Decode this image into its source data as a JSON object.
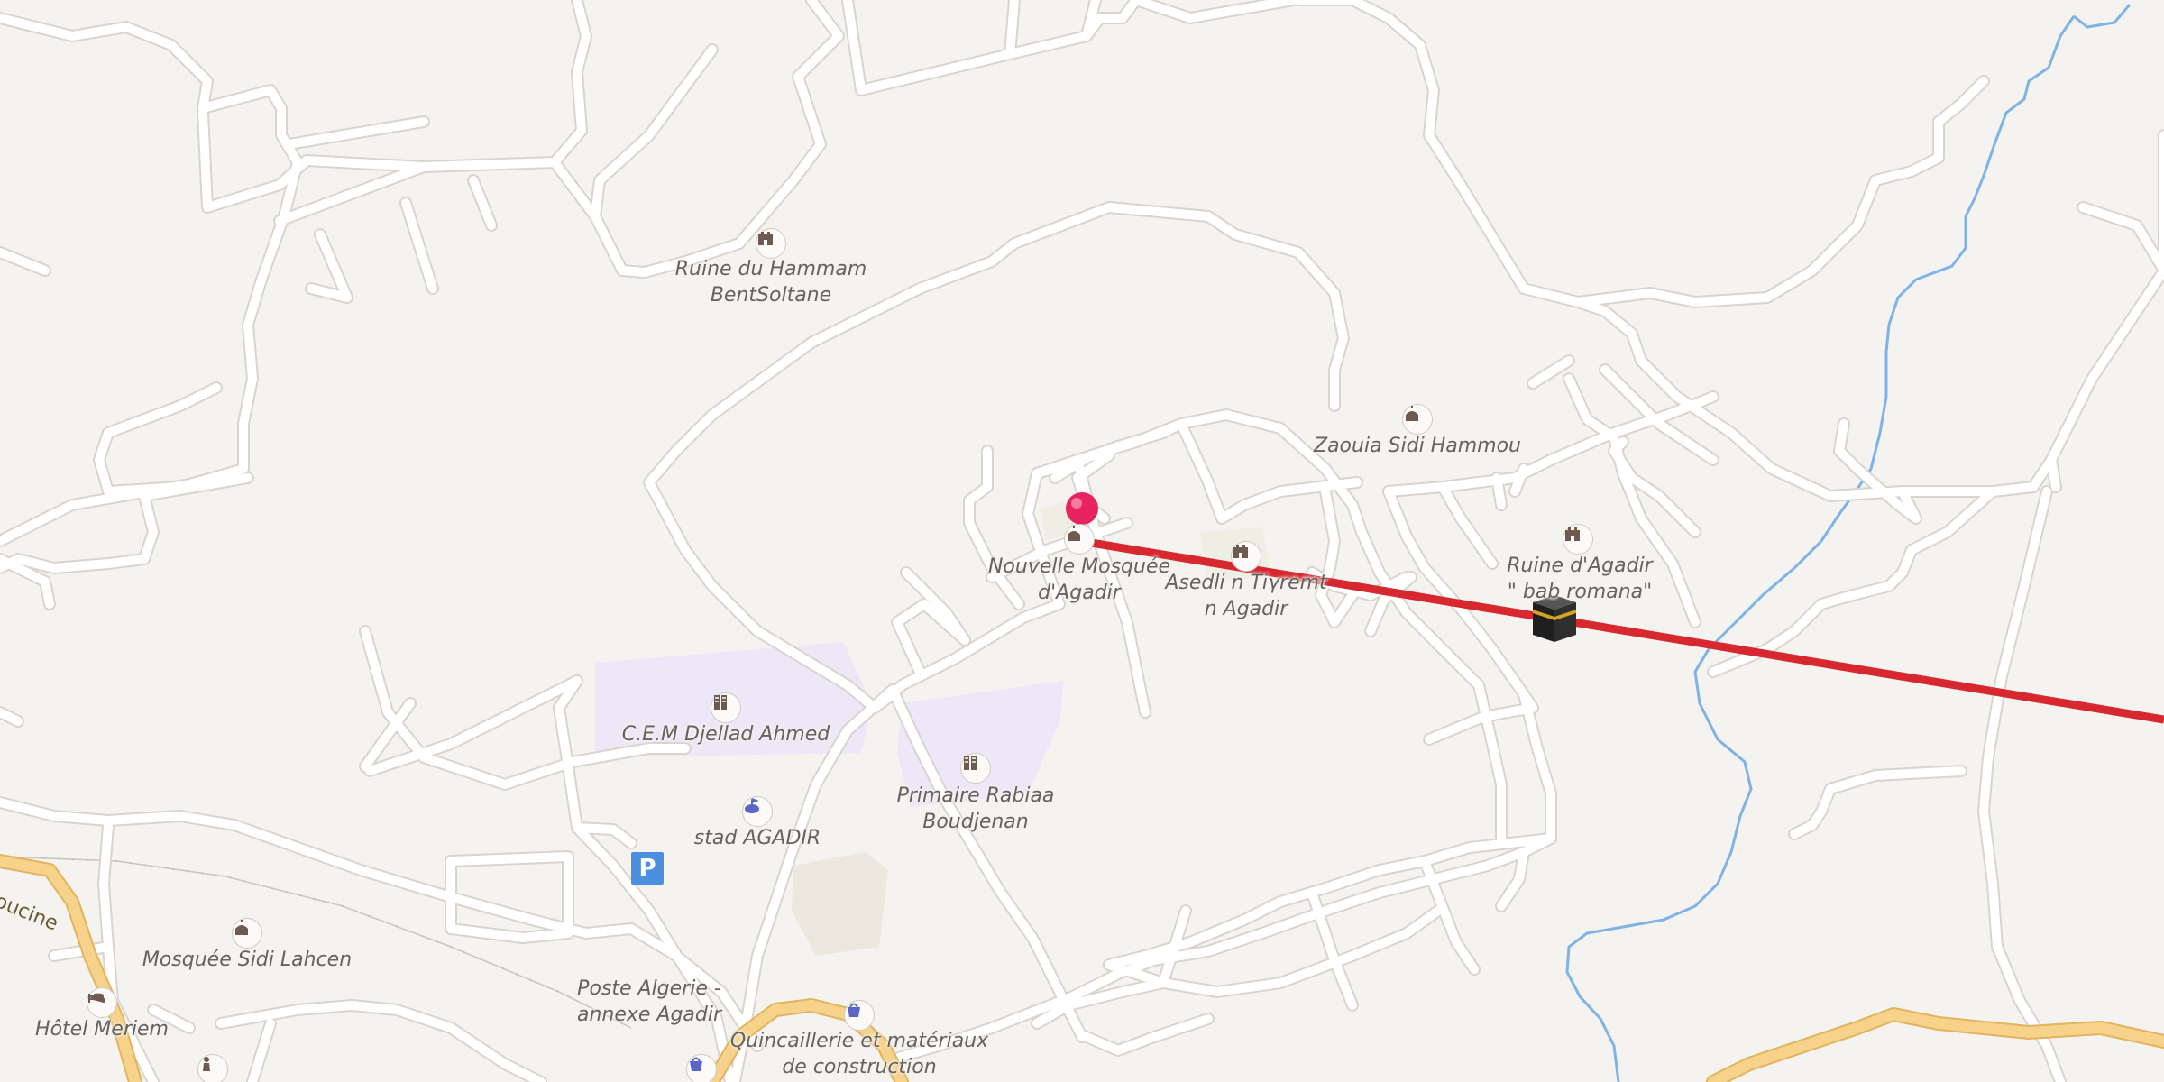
{
  "map": {
    "colors": {
      "background": "#f5f3f0",
      "road": "#ffffff",
      "road_casing": "#d9d4cd",
      "main_road": "#f6d28a",
      "main_road_casing": "#e1b45f",
      "school_area": "#ece8f7",
      "river": "#7fb2e6",
      "route_line": "#d8282f",
      "marker": "#e8245f",
      "poi_icon": "#6e5a4e"
    },
    "places": [
      {
        "id": "ruine-hammam",
        "icon": "ruin-icon",
        "line1": "Ruine du Hammam",
        "line2": "BentSoltane"
      },
      {
        "id": "zaouia",
        "icon": "mosque-icon",
        "line1": "Zaouia Sidi Hammou",
        "line2": ""
      },
      {
        "id": "nouvelle-mosquee",
        "icon": "mosque-icon",
        "line1": "Nouvelle Mosquée",
        "line2": "d'Agadir"
      },
      {
        "id": "asedli",
        "icon": "ruin-icon",
        "line1": "Asedli n Tiγremt",
        "line2": "n Agadir"
      },
      {
        "id": "ruine-agadir",
        "icon": "ruin-icon",
        "line1": "Ruine d'Agadir",
        "line2": "\" bab romana\""
      },
      {
        "id": "cem",
        "icon": "school-icon",
        "line1": "C.E.M Djellad Ahmed",
        "line2": ""
      },
      {
        "id": "primaire",
        "icon": "school-icon",
        "line1": "Primaire Rabiaa",
        "line2": "Boudjenan"
      },
      {
        "id": "stad",
        "icon": "stadium-icon",
        "line1": "stad AGADIR",
        "line2": ""
      },
      {
        "id": "mosquee-sidi-lahcen",
        "icon": "mosque-icon",
        "line1": "Mosquée Sidi Lahcen",
        "line2": ""
      },
      {
        "id": "hotel",
        "icon": "hotel-icon",
        "line1": "Hôtel Meriem",
        "line2": ""
      },
      {
        "id": "poste",
        "icon": "post-icon",
        "line1": "Poste Algerie -",
        "line2": "annexe Agadir"
      },
      {
        "id": "quincaillerie",
        "icon": "shop-icon",
        "line1": "Quincaillerie et matériaux",
        "line2": "de construction"
      }
    ],
    "road_label": "oucine",
    "parking_label": "P",
    "qibla_icon": "kaaba-icon",
    "marker_icon": "location-pin-icon"
  }
}
